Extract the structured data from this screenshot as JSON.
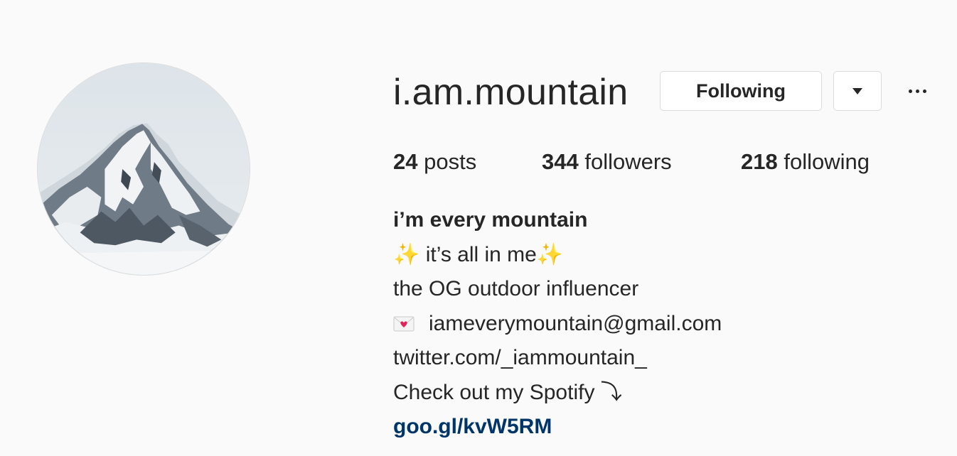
{
  "profile": {
    "username": "i.am.mountain",
    "avatar_icon": "mountain-photo",
    "following_button_label": "Following",
    "dropdown_icon": "caret-down-icon",
    "more_icon": "ellipsis-icon"
  },
  "stats": {
    "posts_count": "24",
    "posts_label": "posts",
    "followers_count": "344",
    "followers_label": "followers",
    "following_count": "218",
    "following_label": "following"
  },
  "bio": {
    "name": "i’m every mountain",
    "line1_prefix": "✨",
    "line1_text": " it’s all in me",
    "line1_suffix": "✨",
    "line2": "the OG outdoor influencer",
    "email_icon": "love-letter-icon",
    "email": "iameverymountain@gmail.com",
    "twitter": "twitter.com/_iammountain_",
    "line5": "Check out my Spotify ⤵",
    "link": "goo.gl/kvW5RM"
  },
  "colors": {
    "background": "#fafafa",
    "text": "#262626",
    "link": "#003569",
    "border": "#dbdbdb"
  }
}
